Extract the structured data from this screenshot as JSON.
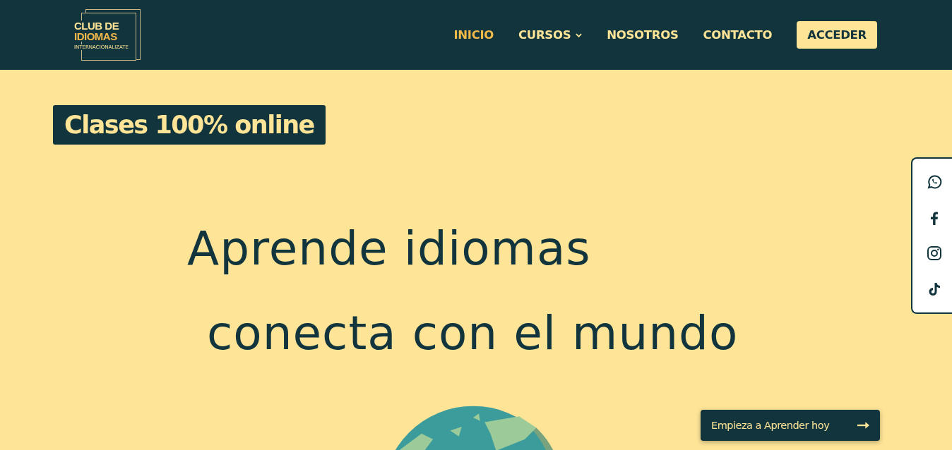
{
  "logo": {
    "line_1": "CLUB DE",
    "line_2": "IDIOMAS",
    "tagline": "INTERNACIONALIZATE"
  },
  "nav": [
    {
      "label": "INICIO",
      "selected": true,
      "dropdown": false
    },
    {
      "label": "CURSOS",
      "selected": false,
      "dropdown": true
    },
    {
      "label": "NOSOTROS",
      "selected": false,
      "dropdown": false
    },
    {
      "label": "CONTACTO",
      "selected": false,
      "dropdown": false
    }
  ],
  "login_button": "ACCEDER",
  "badge": "Clases 100% online",
  "headline": [
    "Aprende idiomas",
    "conecta con el mundo"
  ],
  "social": [
    {
      "kind": "whatsapp"
    },
    {
      "kind": "facebook"
    },
    {
      "kind": "instagram"
    },
    {
      "kind": "tiktok"
    }
  ],
  "cta_button": "Empieza a Aprender hoy"
}
